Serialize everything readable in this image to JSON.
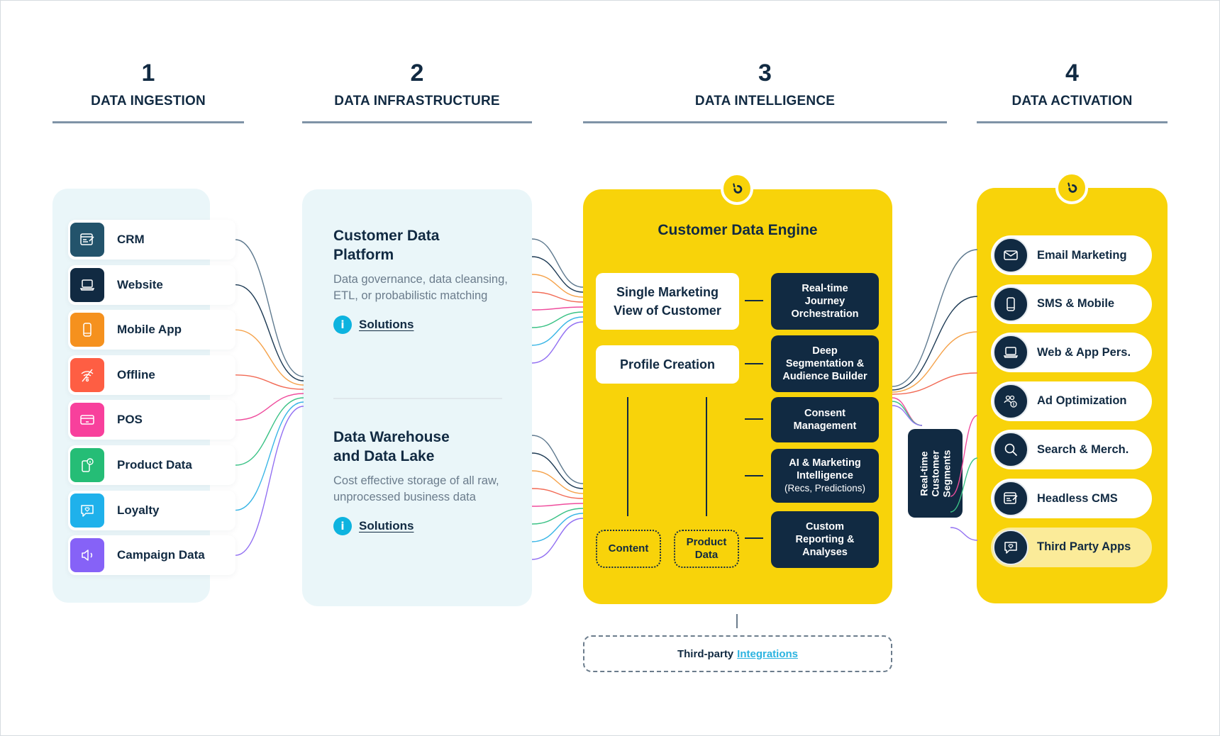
{
  "columns": [
    {
      "number": "1",
      "title": "DATA INGESTION"
    },
    {
      "number": "2",
      "title": "DATA INFRASTRUCTURE"
    },
    {
      "number": "3",
      "title": "DATA INTELLIGENCE"
    },
    {
      "number": "4",
      "title": "DATA ACTIVATION"
    }
  ],
  "ingestion": {
    "sources": [
      {
        "label": "CRM",
        "icon": "crm-edit-icon",
        "color": "#23536b"
      },
      {
        "label": "Website",
        "icon": "laptop-icon",
        "color": "#112a42"
      },
      {
        "label": "Mobile App",
        "icon": "mobile-phone-icon",
        "color": "#f5911e"
      },
      {
        "label": "Offline",
        "icon": "wifi-off-icon",
        "color": "#fe5e43"
      },
      {
        "label": "POS",
        "icon": "credit-card-icon",
        "color": "#f8409c"
      },
      {
        "label": "Product Data",
        "icon": "product-info-icon",
        "color": "#25bd76"
      },
      {
        "label": "Loyalty",
        "icon": "heart-chat-icon",
        "color": "#1fb1eb"
      },
      {
        "label": "Campaign Data",
        "icon": "megaphone-icon",
        "color": "#8662f7"
      }
    ]
  },
  "infrastructure": {
    "cdp": {
      "title_line1": "Customer Data",
      "title_line2": "Platform",
      "description": "Data governance, data cleansing, ETL, or probabilistic matching",
      "link": "Solutions",
      "info_glyph": "i"
    },
    "warehouse": {
      "title_line1": "Data Warehouse",
      "title_line2": "and Data Lake",
      "description": "Cost effective storage of all raw, unprocessed business data",
      "link": "Solutions",
      "info_glyph": "i"
    }
  },
  "intelligence": {
    "title": "Customer Data Engine",
    "single_view_line1": "Single Marketing",
    "single_view_line2": "View of Customer",
    "profile_creation": "Profile Creation",
    "capabilities": [
      {
        "lines": [
          "Real-time",
          "Journey",
          "Orchestration"
        ],
        "sub": ""
      },
      {
        "lines": [
          "Deep",
          "Segmentation &",
          "Audience Builder"
        ],
        "sub": ""
      },
      {
        "lines": [
          "Consent",
          "Management"
        ],
        "sub": ""
      },
      {
        "lines": [
          "AI & Marketing",
          "Intelligence"
        ],
        "sub": "(Recs, Predictions)"
      },
      {
        "lines": [
          "Custom",
          "Reporting &",
          "Analyses"
        ],
        "sub": ""
      }
    ],
    "content_box": "Content",
    "product_data_line1": "Product",
    "product_data_line2": "Data",
    "third_party_prefix": "Third-party",
    "third_party_link": "Integrations",
    "segments_line1": "Real-time",
    "segments_line2": "Customer",
    "segments_line3": "Segments"
  },
  "activation": {
    "channels": [
      {
        "label": "Email Marketing",
        "icon": "envelope-icon",
        "highlighted": false
      },
      {
        "label": "SMS & Mobile",
        "icon": "mobile-phone-icon",
        "highlighted": false
      },
      {
        "label": "Web & App Pers.",
        "icon": "laptop-icon",
        "highlighted": false
      },
      {
        "label": "Ad Optimization",
        "icon": "users-dollar-icon",
        "highlighted": false
      },
      {
        "label": "Search & Merch.",
        "icon": "search-icon",
        "highlighted": false
      },
      {
        "label": "Headless CMS",
        "icon": "cms-edit-icon",
        "highlighted": false
      },
      {
        "label": "Third Party Apps",
        "icon": "heart-chat-icon",
        "highlighted": true
      }
    ]
  },
  "colors": {
    "navy": "#112a42",
    "yellow": "#f8d30a",
    "panel_blue": "#eaf6f9",
    "link_blue": "#2bb3e0",
    "wires": [
      "#5f7a8f",
      "#1d3a54",
      "#f5a24a",
      "#f26a55",
      "#ef4d9d",
      "#3bc286",
      "#3ab6e6",
      "#9270f2"
    ]
  }
}
